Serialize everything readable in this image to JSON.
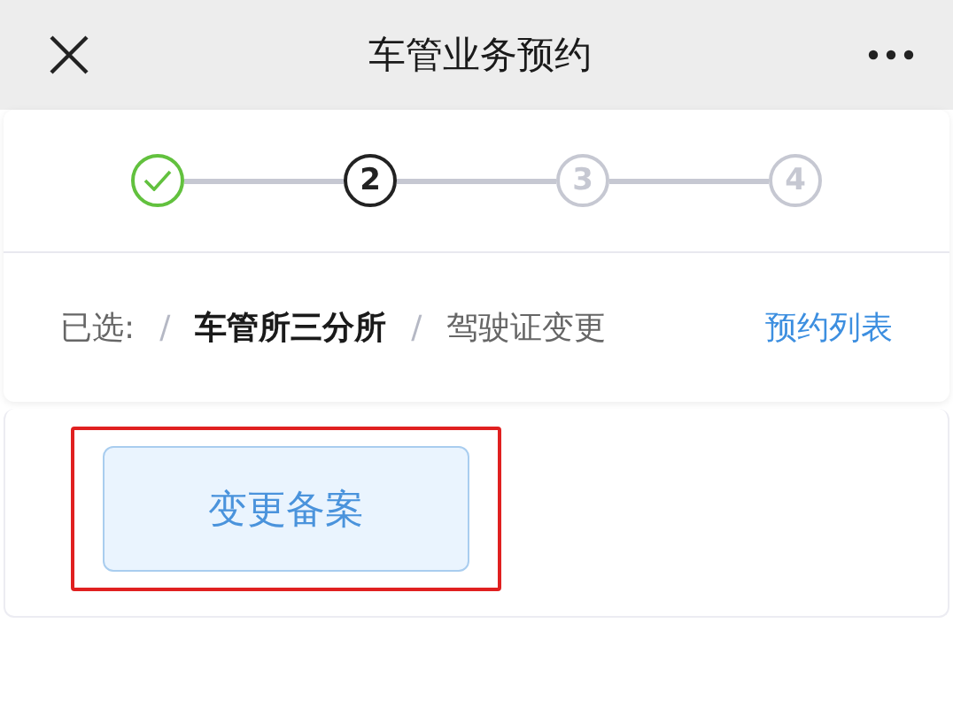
{
  "window": {
    "title": "车管业务预约"
  },
  "steps": [
    {
      "completed": true,
      "selected": false
    },
    {
      "label": "2",
      "completed": false,
      "selected": true
    },
    {
      "label": "3",
      "completed": false,
      "selected": false
    },
    {
      "label": "4",
      "completed": false,
      "selected": false
    }
  ],
  "breadcrumb": {
    "prefix": "已选:",
    "items": [
      {
        "text": "车管所三分所",
        "kind": "strong"
      },
      {
        "text": "驾驶证变更",
        "kind": "plain"
      }
    ],
    "separator": "/",
    "link": "预约列表"
  },
  "options": [
    {
      "label": "变更备案",
      "highlighted": true
    }
  ]
}
